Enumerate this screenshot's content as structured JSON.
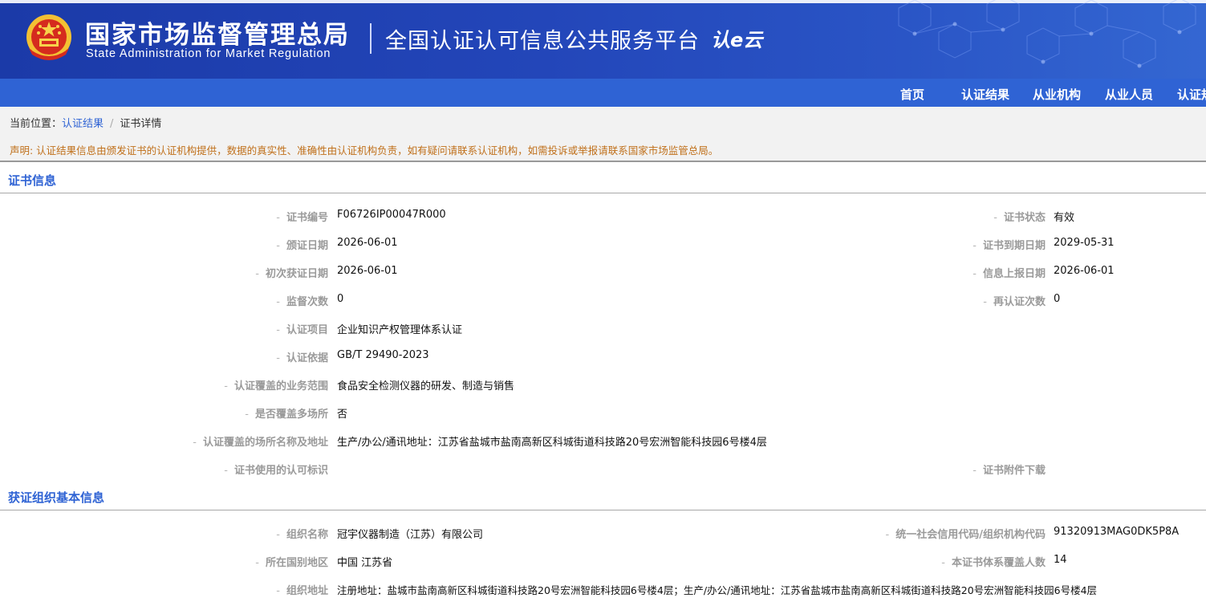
{
  "header": {
    "title_cn": "国家市场监督管理总局",
    "title_en": "State Administration  for  Market Regulation",
    "platform": "全国认证认可信息公共服务平台",
    "logo_text": "认e云"
  },
  "nav": [
    "首页",
    "认证结果",
    "从业机构",
    "从业人员",
    "认证规"
  ],
  "breadcrumb": {
    "prefix": "当前位置：",
    "link": "认证结果",
    "sep": "/",
    "current": "证书详情"
  },
  "notice": "声明: 认证结果信息由颁发证书的认证机构提供，数据的真实性、准确性由认证机构负责，如有疑问请联系认证机构，如需投诉或举报请联系国家市场监管总局。",
  "cert": {
    "section_title": "证书信息",
    "left": [
      {
        "label": "证书编号",
        "value": "F06726IP00047R000"
      },
      {
        "label": "颁证日期",
        "value": "2026-06-01"
      },
      {
        "label": "初次获证日期",
        "value": "2026-06-01"
      },
      {
        "label": "监督次数",
        "value": "0"
      },
      {
        "label": "认证项目",
        "value": "企业知识产权管理体系认证"
      },
      {
        "label": "认证依据",
        "value": "GB/T 29490-2023"
      },
      {
        "label": "认证覆盖的业务范围",
        "value": "食品安全检测仪器的研发、制造与销售"
      },
      {
        "label": "是否覆盖多场所",
        "value": "否"
      },
      {
        "label": "认证覆盖的场所名称及地址",
        "value": "生产/办公/通讯地址：江苏省盐城市盐南高新区科城街道科技路20号宏洲智能科技园6号楼4层"
      },
      {
        "label": "证书使用的认可标识",
        "value": ""
      }
    ],
    "right": [
      {
        "label": "证书状态",
        "value": "有效"
      },
      {
        "label": "证书到期日期",
        "value": "2029-05-31"
      },
      {
        "label": "信息上报日期",
        "value": "2026-06-01"
      },
      {
        "label": "再认证次数",
        "value": "0"
      },
      {
        "label": "证书附件下载",
        "value": ""
      }
    ]
  },
  "org": {
    "section_title": "获证组织基本信息",
    "left": [
      {
        "label": "组织名称",
        "value": "冠宇仪器制造（江苏）有限公司"
      },
      {
        "label": "所在国别地区",
        "value": "中国 江苏省"
      },
      {
        "label": "组织地址",
        "value": "注册地址：盐城市盐南高新区科城街道科技路20号宏洲智能科技园6号楼4层；生产/办公/通讯地址：江苏省盐城市盐南高新区科城街道科技路20号宏洲智能科技园6号楼4层"
      }
    ],
    "right": [
      {
        "label": "统一社会信用代码/组织机构代码",
        "value": "91320913MAG0DK5P8A"
      },
      {
        "label": "本证书体系覆盖人数",
        "value": "14"
      }
    ]
  }
}
